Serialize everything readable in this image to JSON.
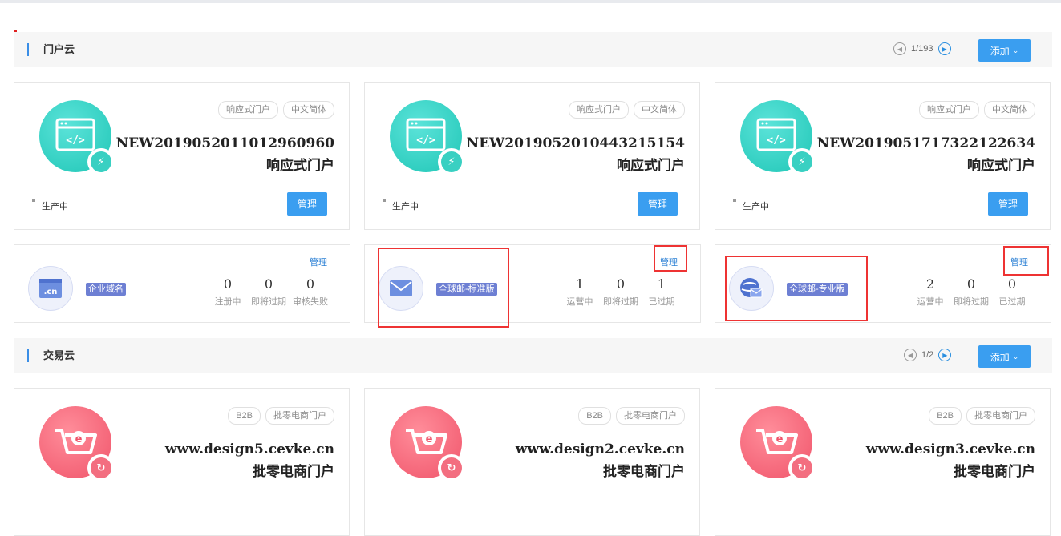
{
  "portal_section": {
    "title": "门户云",
    "pager": "1/193",
    "add_label": "添加",
    "cards": [
      {
        "tags": [
          "响应式门户",
          "中文简体"
        ],
        "title_line1": "NEW2019052011012960960",
        "title_line2": "响应式门户",
        "status": "生产中",
        "manage": "管理"
      },
      {
        "tags": [
          "响应式门户",
          "中文简体"
        ],
        "title_line1": "NEW2019052010443215154",
        "title_line2": "响应式门户",
        "status": "生产中",
        "manage": "管理"
      },
      {
        "tags": [
          "响应式门户",
          "中文简体"
        ],
        "title_line1": "NEW2019051717322122634",
        "title_line2": "响应式门户",
        "status": "生产中",
        "manage": "管理"
      }
    ]
  },
  "services": [
    {
      "label": "企业域名",
      "manage": "管理",
      "icon": "cn-domain-icon",
      "stats": [
        {
          "num": "0",
          "label": "注册中"
        },
        {
          "num": "0",
          "label": "即将过期"
        },
        {
          "num": "0",
          "label": "审核失败"
        }
      ]
    },
    {
      "label": "全球邮-标准版",
      "manage": "管理",
      "icon": "mail-icon",
      "stats": [
        {
          "num": "1",
          "label": "运营中"
        },
        {
          "num": "0",
          "label": "即将过期"
        },
        {
          "num": "1",
          "label": "已过期"
        }
      ]
    },
    {
      "label": "全球邮-专业版",
      "manage": "管理",
      "icon": "global-mail-icon",
      "stats": [
        {
          "num": "2",
          "label": "运营中"
        },
        {
          "num": "0",
          "label": "即将过期"
        },
        {
          "num": "0",
          "label": "已过期"
        }
      ]
    }
  ],
  "trade_section": {
    "title": "交易云",
    "pager": "1/2",
    "add_label": "添加",
    "cards": [
      {
        "tags": [
          "B2B",
          "批零电商门户"
        ],
        "title_line1": "www.design5.cevke.cn",
        "title_line2": "批零电商门户"
      },
      {
        "tags": [
          "B2B",
          "批零电商门户"
        ],
        "title_line1": "www.design2.cevke.cn",
        "title_line2": "批零电商门户"
      },
      {
        "tags": [
          "B2B",
          "批零电商门户"
        ],
        "title_line1": "www.design3.cevke.cn",
        "title_line2": "批零电商门户"
      }
    ]
  },
  "colors": {
    "primary": "#3a9ef0",
    "teal": "#1fc6b6",
    "pink": "#f0546a",
    "highlight": "#e33333"
  }
}
